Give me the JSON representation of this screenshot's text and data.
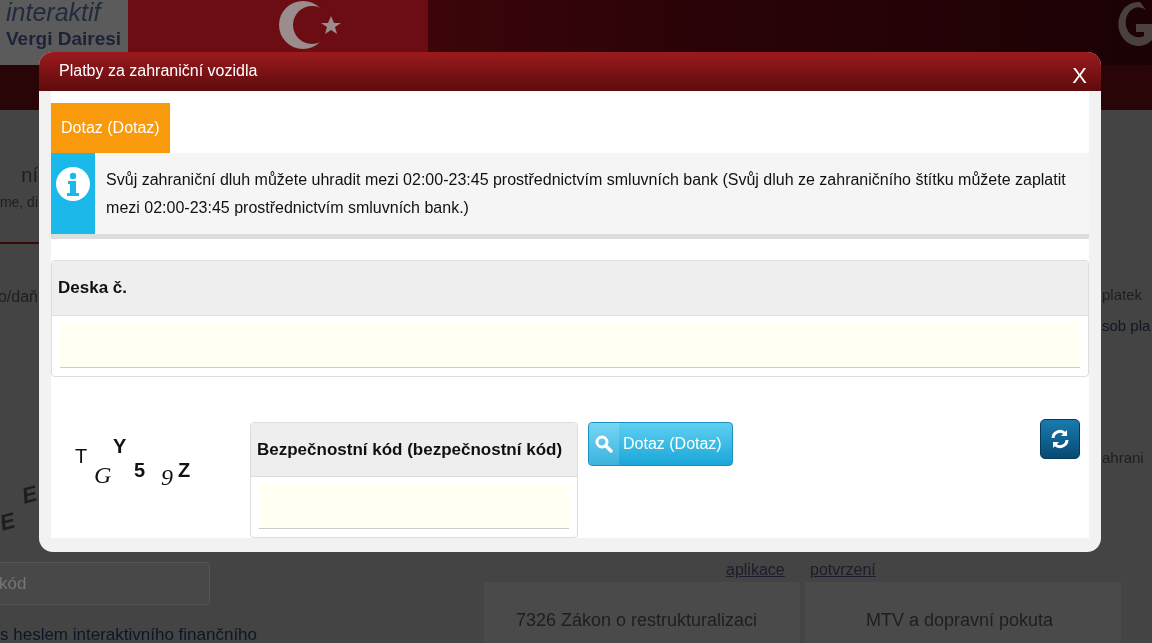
{
  "background": {
    "logo": {
      "line_1": "interaktif",
      "line_2": "Vergi Dairesi"
    },
    "left_fragments": [
      "ní",
      "me, di",
      "o/daň"
    ],
    "captcha_fragments": [
      "E",
      "E"
    ],
    "code_field": {
      "placeholder": "kód"
    },
    "login_link": "s heslem interaktivního finančního",
    "right_fragments": [
      "platek",
      "sob pla",
      "ahrani"
    ],
    "links": [
      "aplikace",
      "potvrzení"
    ],
    "cards": [
      "7326 Zákon o restrukturalizaci",
      "MTV a dopravní pokuta"
    ]
  },
  "modal": {
    "title": "Platby za zahraniční vozidla",
    "close": "X",
    "tabs": [
      {
        "label": "Dotaz (Dotaz)",
        "selected": true
      }
    ],
    "info": "Svůj zahraniční dluh můžete uhradit mezi 02:00-23:45 prostřednictvím smluvních bank (Svůj dluh ze zahraničního štítku můžete zaplatit mezi 02:00-23:45 prostřednictvím smluvních bank.)",
    "plate_field": {
      "label": "Deska č."
    },
    "captcha": [
      "T",
      "G",
      "Y",
      "5",
      "9",
      "Z"
    ],
    "code_field": {
      "label": "Bezpečnostní kód (bezpečnostní kód)"
    },
    "query_button": "Dotaz (Dotaz)"
  }
}
